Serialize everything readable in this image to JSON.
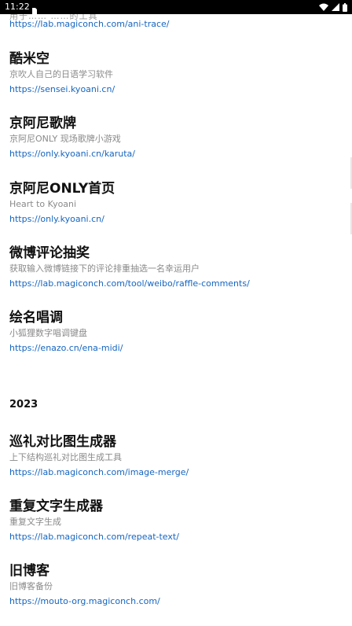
{
  "status_bar": {
    "time": "11:22",
    "icons": [
      "notification-icon",
      "wifi-icon",
      "signal-icon",
      "battery-icon"
    ]
  },
  "top_clip": {
    "description": "用于…… ……的工具",
    "url": "https://lab.magiconch.com/ani-trace/"
  },
  "entries_top": [
    {
      "title": "酷米空",
      "description": "京吹人自己的日语学习软件",
      "url": "https://sensei.kyoani.cn/"
    },
    {
      "title": "京阿尼歌牌",
      "description": "京阿尼ONLY 现场歌牌小游戏",
      "url": "https://only.kyoani.cn/karuta/"
    },
    {
      "title": "京阿尼ONLY首页",
      "description": "Heart to Kyoani",
      "url": "https://only.kyoani.cn/"
    },
    {
      "title": "微博评论抽奖",
      "description": "获取输入微博链接下的评论排重抽选一名幸运用户",
      "url": "https://lab.magiconch.com/tool/weibo/raffle-comments/"
    },
    {
      "title": "绘名唱调",
      "description": "小狐狸数字唱调键盘",
      "url": "https://enazo.cn/ena-midi/"
    }
  ],
  "year_heading": "2023",
  "entries_2023": [
    {
      "title": "巡礼对比图生成器",
      "description": "上下结构巡礼对比图生成工具",
      "url": "https://lab.magiconch.com/image-merge/"
    },
    {
      "title": "重复文字生成器",
      "description": "重复文字生成",
      "url": "https://lab.magiconch.com/repeat-text/"
    },
    {
      "title": "旧博客",
      "description": "旧博客备份",
      "url": "https://mouto-org.magiconch.com/"
    }
  ]
}
